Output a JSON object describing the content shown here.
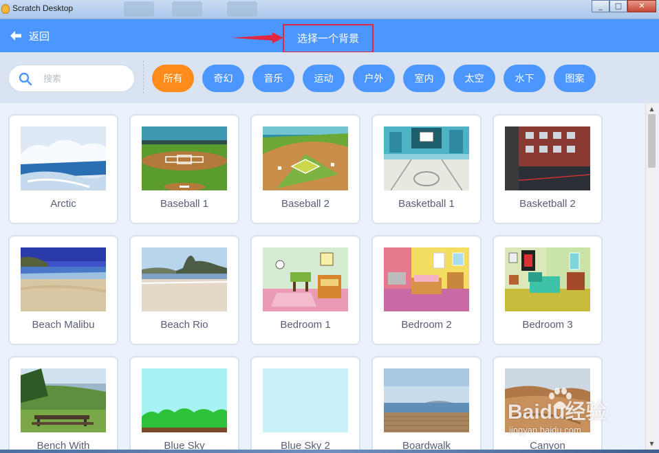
{
  "window": {
    "title": "Scratch Desktop",
    "controls": [
      "_",
      "□",
      "✕"
    ]
  },
  "header": {
    "back_label": "返回",
    "title": "选择一个背景",
    "annotation_color": "#e3263f"
  },
  "search": {
    "placeholder": "搜索",
    "value": ""
  },
  "tags": [
    {
      "label": "所有",
      "active": true
    },
    {
      "label": "奇幻",
      "active": false
    },
    {
      "label": "音乐",
      "active": false
    },
    {
      "label": "运动",
      "active": false
    },
    {
      "label": "户外",
      "active": false
    },
    {
      "label": "室内",
      "active": false
    },
    {
      "label": "太空",
      "active": false
    },
    {
      "label": "水下",
      "active": false
    },
    {
      "label": "图案",
      "active": false
    }
  ],
  "backdrops": [
    {
      "name": "Arctic",
      "thumb": "arctic"
    },
    {
      "name": "Baseball 1",
      "thumb": "baseball1"
    },
    {
      "name": "Baseball 2",
      "thumb": "baseball2"
    },
    {
      "name": "Basketball 1",
      "thumb": "basketball1"
    },
    {
      "name": "Basketball 2",
      "thumb": "basketball2"
    },
    {
      "name": "Beach Malibu",
      "thumb": "beach-malibu"
    },
    {
      "name": "Beach Rio",
      "thumb": "beach-rio"
    },
    {
      "name": "Bedroom 1",
      "thumb": "bedroom1"
    },
    {
      "name": "Bedroom 2",
      "thumb": "bedroom2"
    },
    {
      "name": "Bedroom 3",
      "thumb": "bedroom3"
    },
    {
      "name": "Bench With",
      "thumb": "bench-with-view"
    },
    {
      "name": "Blue Sky",
      "thumb": "blue-sky"
    },
    {
      "name": "Blue Sky 2",
      "thumb": "blue-sky2"
    },
    {
      "name": "Boardwalk",
      "thumb": "boardwalk"
    },
    {
      "name": "Canyon",
      "thumb": "canyon"
    }
  ],
  "colors": {
    "header": "#4c97ff",
    "active_tag": "#ff8c1a",
    "tag": "#4c97ff",
    "label_text": "#575e75"
  },
  "watermark": {
    "main": "Baidu经验",
    "sub": "jingyan.baidu.com"
  }
}
